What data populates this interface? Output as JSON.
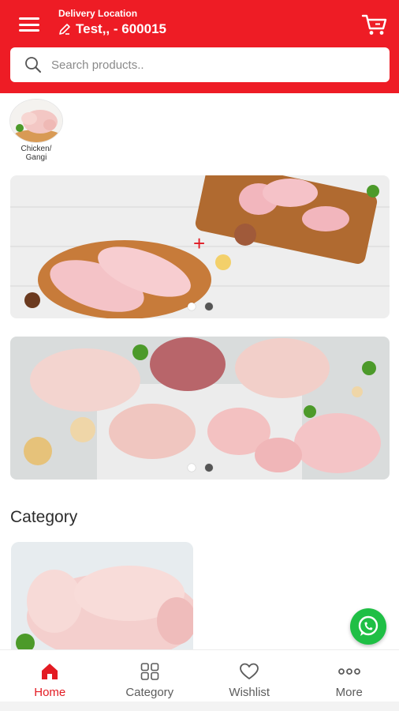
{
  "header": {
    "delivery_label": "Delivery Location",
    "location_text": "Test,,  - 600015",
    "icons": {
      "menu": "menu-icon",
      "edit": "edit-icon",
      "cart": "cart-icon"
    },
    "color": "#ee1c25"
  },
  "search": {
    "placeholder": "Search products.."
  },
  "chips": [
    {
      "label_line1": "Chicken/",
      "label_line2": "Gangi"
    }
  ],
  "banners": {
    "count": 2,
    "dots_per_banner": 2,
    "active_dot_index": 0
  },
  "category_section": {
    "title": "Category"
  },
  "nav": {
    "items": [
      {
        "label": "Home",
        "icon": "home-icon",
        "active": true
      },
      {
        "label": "Category",
        "icon": "grid-icon",
        "active": false
      },
      {
        "label": "Wishlist",
        "icon": "heart-icon",
        "active": false
      },
      {
        "label": "More",
        "icon": "more-icon",
        "active": false
      }
    ],
    "active_color": "#e31b23"
  },
  "floating": {
    "icon": "whatsapp-icon",
    "color": "#1fbf45"
  }
}
